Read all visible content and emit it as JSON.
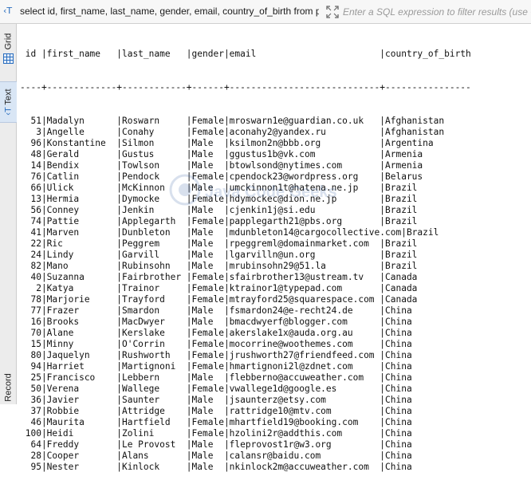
{
  "toolbar": {
    "sql_icon": "sql-text-icon",
    "query": "select id, first_name, last_name, gender, email, country_of_birth from p",
    "filter_placeholder": "Enter a SQL expression to filter results (use Ct"
  },
  "sidepanel": {
    "grid_label": "Grid",
    "text_label": "Text",
    "text_icon": "‹T",
    "record_label": "Record"
  },
  "watermark": {
    "text": "Java Code Geeks"
  },
  "table": {
    "header": " id |first_name   |last_name   |gender|email                       |country_of_birth",
    "separator": "----+-------------+------------+------+----------------------------+----------------",
    "rows": [
      "  51|Madalyn      |Roswarn     |Female|mroswarn1e@guardian.co.uk   |Afghanistan",
      "   3|Angelle      |Conahy      |Female|aconahy2@yandex.ru          |Afghanistan",
      "  96|Konstantine  |Silmon      |Male  |ksilmon2n@bbb.org           |Argentina",
      "  48|Gerald       |Gustus      |Male  |ggustus1b@vk.com            |Armenia",
      "  14|Bendix       |Towlson     |Male  |btowlsond@nytimes.com       |Armenia",
      "  76|Catlin       |Pendock     |Female|cpendock23@wordpress.org    |Belarus",
      "  66|Ulick        |McKinnon    |Male  |umckinnon1t@hatena.ne.jp    |Brazil",
      "  13|Hermia       |Dymocke     |Female|hdymockec@dion.ne.jp        |Brazil",
      "  56|Conney       |Jenkin      |Male  |cjenkin1j@si.edu            |Brazil",
      "  74|Pattie       |Applegarth  |Female|papplegarth21@pbs.org       |Brazil",
      "  41|Marven       |Dunbleton   |Male  |mdunbleton14@cargocollective.com|Brazil",
      "  22|Ric          |Peggrem     |Male  |rpeggreml@domainmarket.com  |Brazil",
      "  24|Lindy        |Garvill     |Male  |lgarvilln@un.org            |Brazil",
      "  82|Mano         |Rubinsohn   |Male  |mrubinsohn29@51.la          |Brazil",
      "  40|Suzanna      |Fairbrother |Female|sfairbrother13@ustream.tv   |Canada",
      "   2|Katya        |Trainor     |Female|ktrainor1@typepad.com       |Canada",
      "  78|Marjorie     |Trayford    |Female|mtrayford25@squarespace.com |Canada",
      "  77|Frazer       |Smardon     |Male  |fsmardon24@e-recht24.de     |China",
      "  16|Brooks       |MacDwyer    |Male  |bmacdwyerf@blogger.com      |China",
      "  70|Alane        |Kerslake    |Female|akerslake1x@auda.org.au     |China",
      "  15|Minny        |O'Corrin    |Female|mocorrine@woothemes.com     |China",
      "  80|Jaquelyn     |Rushworth   |Female|jrushworth27@friendfeed.com |China",
      "  94|Harriet      |Martignoni  |Female|hmartignoni2l@zdnet.com     |China",
      "  25|Francisco    |Lebbern     |Male  |flebberno@accuweather.com   |China",
      "  50|Verena       |Wallege     |Female|vwallege1d@google.es        |China",
      "  36|Javier       |Saunter     |Male  |jsaunterz@etsy.com          |China",
      "  37|Robbie       |Attridge    |Male  |rattridge10@mtv.com         |China",
      "  46|Maurita      |Hartfield   |Female|mhartfield19@booking.com    |China",
      " 100|Heidi        |Zolini      |Female|hzolini2r@addthis.com       |China",
      "  64|Freddy       |Le Provost  |Male  |fleprovost1r@w3.org         |China",
      "  28|Cooper       |Alans       |Male  |calansr@baidu.com           |China",
      "  95|Nester       |Kinlock     |Male  |nkinlock2m@accuweather.com  |China"
    ]
  }
}
